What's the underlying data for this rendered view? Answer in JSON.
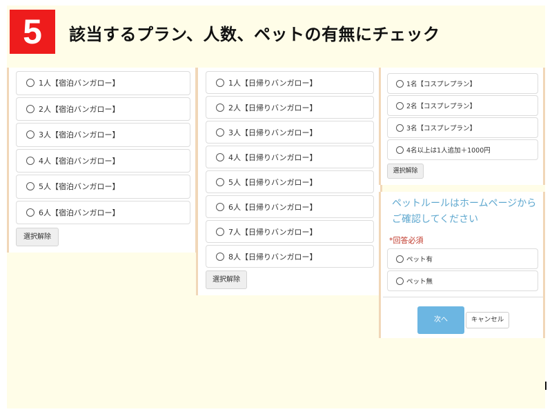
{
  "header": {
    "step_number": "5",
    "title": "該当するプラン、人数、ペットの有無にチェック"
  },
  "colors": {
    "badge": "#ee1c1c",
    "page_background": "#fffde8",
    "panel_border": "#f1d7b8",
    "note_text": "#5fa8cf",
    "required_text": "#c0392b",
    "next_button": "#6cb6e2"
  },
  "icons": {
    "option_marker": "radio-circle-icon"
  },
  "stay_plan": {
    "options": [
      "1人【宿泊バンガロー】",
      "2人【宿泊バンガロー】",
      "3人【宿泊バンガロー】",
      "4人【宿泊バンガロー】",
      "5人【宿泊バンガロー】",
      "6人【宿泊バンガロー】"
    ],
    "clear_label": "選択解除"
  },
  "day_plan": {
    "options": [
      "1人【日帰りバンガロー】",
      "2人【日帰りバンガロー】",
      "3人【日帰りバンガロー】",
      "4人【日帰りバンガロー】",
      "5人【日帰りバンガロー】",
      "6人【日帰りバンガロー】",
      "7人【日帰りバンガロー】",
      "8人【日帰りバンガロー】"
    ],
    "clear_label": "選択解除"
  },
  "cosplay_plan": {
    "options": [
      "1名【コスプレプラン】",
      "2名【コスプレプラン】",
      "3名【コスプレプラン】",
      "4名以上は1人追加＋1000円"
    ],
    "clear_label": "選択解除"
  },
  "pet": {
    "note": "ペットルールはホームページからご確認してください",
    "required_label": "*回答必須",
    "options": [
      "ペット有",
      "ペット無"
    ]
  },
  "actions": {
    "next_label": "次へ",
    "cancel_label": "キャンセル"
  }
}
